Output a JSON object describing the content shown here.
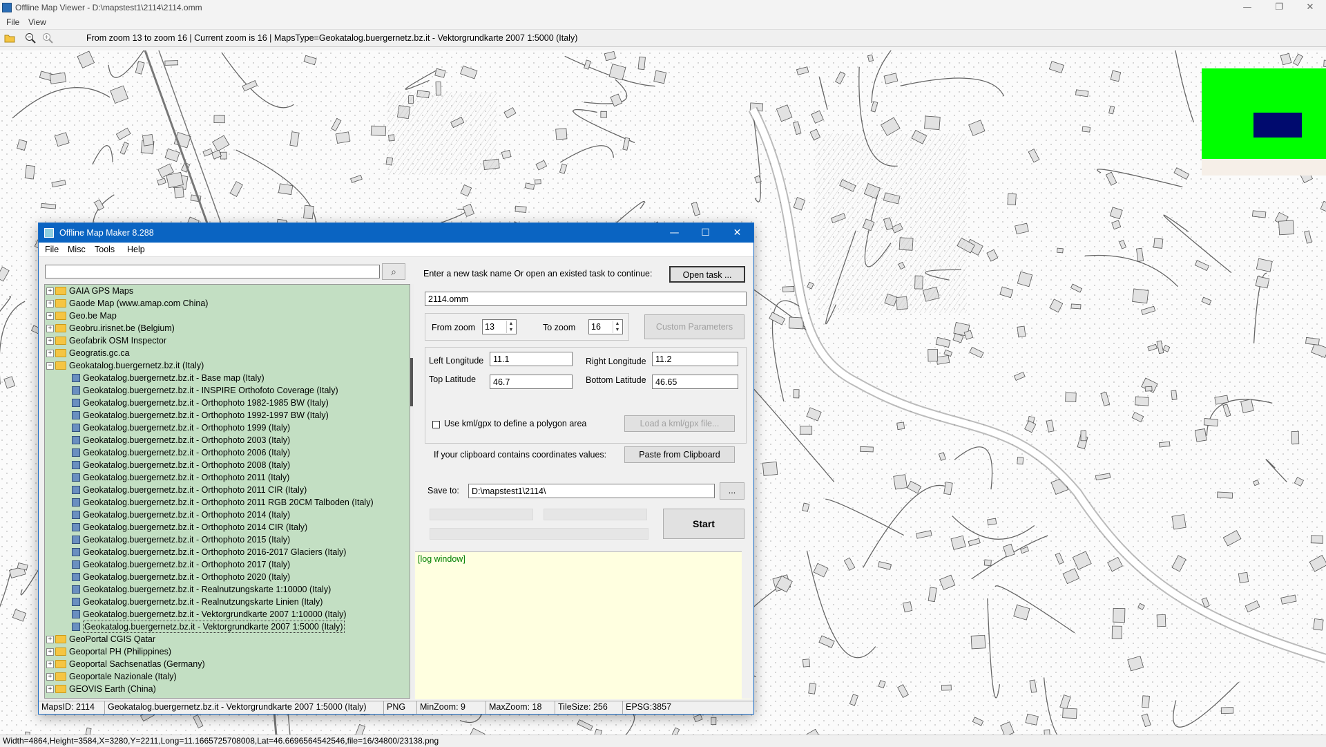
{
  "outer_window": {
    "title": "Offline Map Viewer - D:\\mapstest1\\2114\\2114.omm",
    "menu": [
      "File",
      "View"
    ],
    "toolbar_info": "From zoom 13 to zoom 16   |   Current zoom is 16   |   MapsType=Geokatalog.buergernetz.bz.it - Vektorgrundkarte 2007 1:5000 (Italy)",
    "status": "Width=4864,Height=3584,X=3280,Y=2211,Long=11.1665725708008,Lat=46.6696564542546,file=16/34800/23138.png",
    "controls": {
      "minimize": "—",
      "maximize": "❐",
      "close": "✕"
    }
  },
  "colors": {
    "dialog_title": "#0a64c2",
    "tree_bg": "#c3dfc3",
    "log_bg": "#ffffe0",
    "overview_bg": "#00ff00",
    "overview_rect": "#000a6e"
  },
  "dialog": {
    "title": "Offline Map Maker 8.288",
    "menu": [
      "File",
      "Misc",
      "Tools",
      "Help"
    ],
    "search": {
      "value": "",
      "icon": "search-icon"
    },
    "tree": [
      {
        "label": "GAIA GPS Maps",
        "type": "folder",
        "expanded": false
      },
      {
        "label": "Gaode Map (www.amap.com China)",
        "type": "folder",
        "expanded": false
      },
      {
        "label": "Geo.be Map",
        "type": "folder",
        "expanded": false
      },
      {
        "label": "Geobru.irisnet.be (Belgium)",
        "type": "folder",
        "expanded": false
      },
      {
        "label": "Geofabrik OSM Inspector",
        "type": "folder",
        "expanded": false
      },
      {
        "label": "Geogratis.gc.ca",
        "type": "folder",
        "expanded": false
      },
      {
        "label": "Geokatalog.buergernetz.bz.it (Italy)",
        "type": "folder",
        "expanded": true
      },
      {
        "label": "Geokatalog.buergernetz.bz.it - Base map (Italy)",
        "type": "map"
      },
      {
        "label": "Geokatalog.buergernetz.bz.it - INSPIRE Orthofoto Coverage (Italy)",
        "type": "map"
      },
      {
        "label": "Geokatalog.buergernetz.bz.it - Orthophoto 1982-1985 BW (Italy)",
        "type": "map"
      },
      {
        "label": "Geokatalog.buergernetz.bz.it - Orthophoto 1992-1997 BW (Italy)",
        "type": "map"
      },
      {
        "label": "Geokatalog.buergernetz.bz.it - Orthophoto 1999 (Italy)",
        "type": "map"
      },
      {
        "label": "Geokatalog.buergernetz.bz.it - Orthophoto 2003 (Italy)",
        "type": "map"
      },
      {
        "label": "Geokatalog.buergernetz.bz.it - Orthophoto 2006 (Italy)",
        "type": "map"
      },
      {
        "label": "Geokatalog.buergernetz.bz.it - Orthophoto 2008 (Italy)",
        "type": "map"
      },
      {
        "label": "Geokatalog.buergernetz.bz.it - Orthophoto 2011 (Italy)",
        "type": "map"
      },
      {
        "label": "Geokatalog.buergernetz.bz.it - Orthophoto 2011 CIR (Italy)",
        "type": "map"
      },
      {
        "label": "Geokatalog.buergernetz.bz.it - Orthophoto 2011 RGB 20CM Talboden (Italy)",
        "type": "map"
      },
      {
        "label": "Geokatalog.buergernetz.bz.it - Orthophoto 2014 (Italy)",
        "type": "map"
      },
      {
        "label": "Geokatalog.buergernetz.bz.it - Orthophoto 2014 CIR (Italy)",
        "type": "map"
      },
      {
        "label": "Geokatalog.buergernetz.bz.it - Orthophoto 2015 (Italy)",
        "type": "map"
      },
      {
        "label": "Geokatalog.buergernetz.bz.it - Orthophoto 2016-2017 Glaciers (Italy)",
        "type": "map"
      },
      {
        "label": "Geokatalog.buergernetz.bz.it - Orthophoto 2017 (Italy)",
        "type": "map"
      },
      {
        "label": "Geokatalog.buergernetz.bz.it - Orthophoto 2020 (Italy)",
        "type": "map"
      },
      {
        "label": "Geokatalog.buergernetz.bz.it - Realnutzungskarte 1:10000 (Italy)",
        "type": "map"
      },
      {
        "label": "Geokatalog.buergernetz.bz.it - Realnutzungskarte Linien (Italy)",
        "type": "map"
      },
      {
        "label": "Geokatalog.buergernetz.bz.it - Vektorgrundkarte 2007 1:10000 (Italy)",
        "type": "map"
      },
      {
        "label": "Geokatalog.buergernetz.bz.it - Vektorgrundkarte 2007 1:5000 (Italy)",
        "type": "map",
        "selected": true
      },
      {
        "label": "GeoPortal CGIS Qatar",
        "type": "folder",
        "expanded": false
      },
      {
        "label": "Geoportal PH (Philippines)",
        "type": "folder",
        "expanded": false
      },
      {
        "label": "Geoportal Sachsenatlas (Germany)",
        "type": "folder",
        "expanded": false
      },
      {
        "label": "Geoportale Nazionale (Italy)",
        "type": "folder",
        "expanded": false
      },
      {
        "label": "GEOVIS Earth (China)",
        "type": "folder",
        "expanded": false
      }
    ],
    "task_prompt": "Enter a new task name Or open an existed task to continue:",
    "open_task_button": "Open task ...",
    "task_name": "2114.omm",
    "from_zoom_label": "From zoom",
    "from_zoom": "13",
    "to_zoom_label": "To zoom",
    "to_zoom": "16",
    "custom_params_button": "Custom Parameters",
    "left_longitude_label": "Left Longitude",
    "left_longitude": "11.1",
    "right_longitude_label": "Right Longitude",
    "right_longitude": "11.2",
    "top_latitude_label": "Top Latitude",
    "top_latitude": "46.7",
    "bottom_latitude_label": "Bottom Latitude",
    "bottom_latitude": "46.65",
    "kml_checkbox_label": "Use kml/gpx to define a polygon area",
    "load_kml_button": "Load a kml/gpx file...",
    "clipboard_label": "If your clipboard contains coordinates values:",
    "paste_button": "Paste from Clipboard",
    "save_to_label": "Save to:",
    "save_to": "D:\\mapstest1\\2114\\",
    "browse_button": "...",
    "start_button": "Start",
    "log_text": "[log window]",
    "status": {
      "maps_id": "MapsID: 2114",
      "maps_name": "Geokatalog.buergernetz.bz.it - Vektorgrundkarte 2007 1:5000 (Italy)",
      "format": "PNG",
      "min_zoom": "MinZoom: 9",
      "max_zoom": "MaxZoom: 18",
      "tile_size": "TileSize: 256",
      "epsg": "EPSG:3857"
    },
    "controls": {
      "minimize": "—",
      "maximize": "☐",
      "close": "✕"
    }
  }
}
